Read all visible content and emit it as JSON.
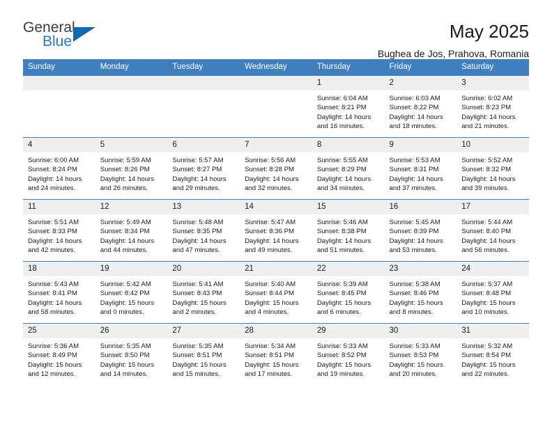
{
  "brand": {
    "name_top": "General",
    "name_bottom": "Blue",
    "accent_color": "#1268b3",
    "triangle_icon": "triangle-icon"
  },
  "header": {
    "title": "May 2025",
    "subtitle": "Bughea de Jos, Prahova, Romania"
  },
  "calendar": {
    "header_bg": "#3f7fbf",
    "daynum_bg": "#efefef",
    "weekday_headers": [
      "Sunday",
      "Monday",
      "Tuesday",
      "Wednesday",
      "Thursday",
      "Friday",
      "Saturday"
    ],
    "weeks": [
      [
        {
          "day": "",
          "empty": true,
          "lines": []
        },
        {
          "day": "",
          "empty": true,
          "lines": []
        },
        {
          "day": "",
          "empty": true,
          "lines": []
        },
        {
          "day": "",
          "empty": true,
          "lines": []
        },
        {
          "day": "1",
          "empty": false,
          "lines": [
            "Sunrise: 6:04 AM",
            "Sunset: 8:21 PM",
            "Daylight: 14 hours",
            "and 16 minutes."
          ]
        },
        {
          "day": "2",
          "empty": false,
          "lines": [
            "Sunrise: 6:03 AM",
            "Sunset: 8:22 PM",
            "Daylight: 14 hours",
            "and 18 minutes."
          ]
        },
        {
          "day": "3",
          "empty": false,
          "lines": [
            "Sunrise: 6:02 AM",
            "Sunset: 8:23 PM",
            "Daylight: 14 hours",
            "and 21 minutes."
          ]
        }
      ],
      [
        {
          "day": "4",
          "empty": false,
          "lines": [
            "Sunrise: 6:00 AM",
            "Sunset: 8:24 PM",
            "Daylight: 14 hours",
            "and 24 minutes."
          ]
        },
        {
          "day": "5",
          "empty": false,
          "lines": [
            "Sunrise: 5:59 AM",
            "Sunset: 8:26 PM",
            "Daylight: 14 hours",
            "and 26 minutes."
          ]
        },
        {
          "day": "6",
          "empty": false,
          "lines": [
            "Sunrise: 5:57 AM",
            "Sunset: 8:27 PM",
            "Daylight: 14 hours",
            "and 29 minutes."
          ]
        },
        {
          "day": "7",
          "empty": false,
          "lines": [
            "Sunrise: 5:56 AM",
            "Sunset: 8:28 PM",
            "Daylight: 14 hours",
            "and 32 minutes."
          ]
        },
        {
          "day": "8",
          "empty": false,
          "lines": [
            "Sunrise: 5:55 AM",
            "Sunset: 8:29 PM",
            "Daylight: 14 hours",
            "and 34 minutes."
          ]
        },
        {
          "day": "9",
          "empty": false,
          "lines": [
            "Sunrise: 5:53 AM",
            "Sunset: 8:31 PM",
            "Daylight: 14 hours",
            "and 37 minutes."
          ]
        },
        {
          "day": "10",
          "empty": false,
          "lines": [
            "Sunrise: 5:52 AM",
            "Sunset: 8:32 PM",
            "Daylight: 14 hours",
            "and 39 minutes."
          ]
        }
      ],
      [
        {
          "day": "11",
          "empty": false,
          "lines": [
            "Sunrise: 5:51 AM",
            "Sunset: 8:33 PM",
            "Daylight: 14 hours",
            "and 42 minutes."
          ]
        },
        {
          "day": "12",
          "empty": false,
          "lines": [
            "Sunrise: 5:49 AM",
            "Sunset: 8:34 PM",
            "Daylight: 14 hours",
            "and 44 minutes."
          ]
        },
        {
          "day": "13",
          "empty": false,
          "lines": [
            "Sunrise: 5:48 AM",
            "Sunset: 8:35 PM",
            "Daylight: 14 hours",
            "and 47 minutes."
          ]
        },
        {
          "day": "14",
          "empty": false,
          "lines": [
            "Sunrise: 5:47 AM",
            "Sunset: 8:36 PM",
            "Daylight: 14 hours",
            "and 49 minutes."
          ]
        },
        {
          "day": "15",
          "empty": false,
          "lines": [
            "Sunrise: 5:46 AM",
            "Sunset: 8:38 PM",
            "Daylight: 14 hours",
            "and 51 minutes."
          ]
        },
        {
          "day": "16",
          "empty": false,
          "lines": [
            "Sunrise: 5:45 AM",
            "Sunset: 8:39 PM",
            "Daylight: 14 hours",
            "and 53 minutes."
          ]
        },
        {
          "day": "17",
          "empty": false,
          "lines": [
            "Sunrise: 5:44 AM",
            "Sunset: 8:40 PM",
            "Daylight: 14 hours",
            "and 56 minutes."
          ]
        }
      ],
      [
        {
          "day": "18",
          "empty": false,
          "lines": [
            "Sunrise: 5:43 AM",
            "Sunset: 8:41 PM",
            "Daylight: 14 hours",
            "and 58 minutes."
          ]
        },
        {
          "day": "19",
          "empty": false,
          "lines": [
            "Sunrise: 5:42 AM",
            "Sunset: 8:42 PM",
            "Daylight: 15 hours",
            "and 0 minutes."
          ]
        },
        {
          "day": "20",
          "empty": false,
          "lines": [
            "Sunrise: 5:41 AM",
            "Sunset: 8:43 PM",
            "Daylight: 15 hours",
            "and 2 minutes."
          ]
        },
        {
          "day": "21",
          "empty": false,
          "lines": [
            "Sunrise: 5:40 AM",
            "Sunset: 8:44 PM",
            "Daylight: 15 hours",
            "and 4 minutes."
          ]
        },
        {
          "day": "22",
          "empty": false,
          "lines": [
            "Sunrise: 5:39 AM",
            "Sunset: 8:45 PM",
            "Daylight: 15 hours",
            "and 6 minutes."
          ]
        },
        {
          "day": "23",
          "empty": false,
          "lines": [
            "Sunrise: 5:38 AM",
            "Sunset: 8:46 PM",
            "Daylight: 15 hours",
            "and 8 minutes."
          ]
        },
        {
          "day": "24",
          "empty": false,
          "lines": [
            "Sunrise: 5:37 AM",
            "Sunset: 8:48 PM",
            "Daylight: 15 hours",
            "and 10 minutes."
          ]
        }
      ],
      [
        {
          "day": "25",
          "empty": false,
          "lines": [
            "Sunrise: 5:36 AM",
            "Sunset: 8:49 PM",
            "Daylight: 15 hours",
            "and 12 minutes."
          ]
        },
        {
          "day": "26",
          "empty": false,
          "lines": [
            "Sunrise: 5:35 AM",
            "Sunset: 8:50 PM",
            "Daylight: 15 hours",
            "and 14 minutes."
          ]
        },
        {
          "day": "27",
          "empty": false,
          "lines": [
            "Sunrise: 5:35 AM",
            "Sunset: 8:51 PM",
            "Daylight: 15 hours",
            "and 15 minutes."
          ]
        },
        {
          "day": "28",
          "empty": false,
          "lines": [
            "Sunrise: 5:34 AM",
            "Sunset: 8:51 PM",
            "Daylight: 15 hours",
            "and 17 minutes."
          ]
        },
        {
          "day": "29",
          "empty": false,
          "lines": [
            "Sunrise: 5:33 AM",
            "Sunset: 8:52 PM",
            "Daylight: 15 hours",
            "and 19 minutes."
          ]
        },
        {
          "day": "30",
          "empty": false,
          "lines": [
            "Sunrise: 5:33 AM",
            "Sunset: 8:53 PM",
            "Daylight: 15 hours",
            "and 20 minutes."
          ]
        },
        {
          "day": "31",
          "empty": false,
          "lines": [
            "Sunrise: 5:32 AM",
            "Sunset: 8:54 PM",
            "Daylight: 15 hours",
            "and 22 minutes."
          ]
        }
      ]
    ]
  }
}
